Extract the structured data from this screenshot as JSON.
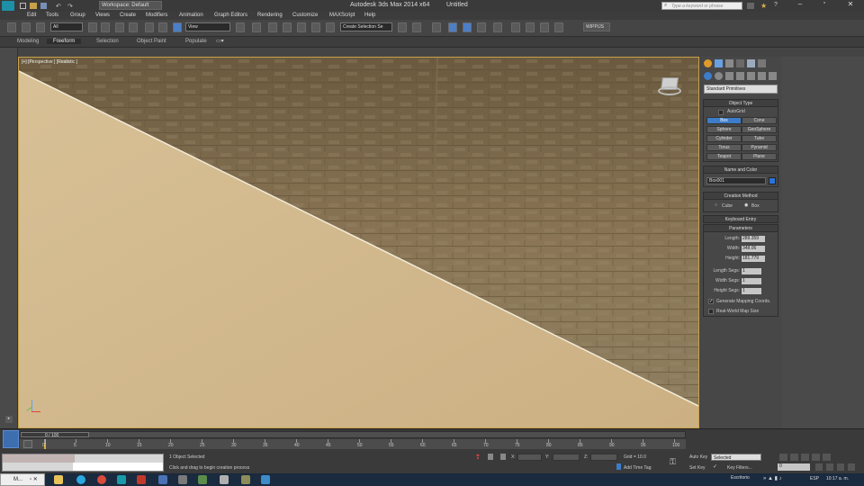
{
  "window": {
    "title": "Autodesk 3ds Max  2014 x64",
    "doc_title": "Untitled",
    "workspace": "Workspace: Default",
    "search_placeholder": "Type a keyword or phrase"
  },
  "menu": [
    "Edit",
    "Tools",
    "Group",
    "Views",
    "Create",
    "Modifiers",
    "Animation",
    "Graph Editors",
    "Rendering",
    "Customize",
    "MAXScript",
    "Help"
  ],
  "toolbar": {
    "filter": "All",
    "ref_coord": "View",
    "selection_set": "Create Selection Se",
    "vray_btn": "WIPP/JS"
  },
  "ribbon": {
    "tabs": [
      "Modeling",
      "Freeform",
      "Selection",
      "Object Paint",
      "Populate"
    ],
    "active": "Freeform"
  },
  "viewport": {
    "label": "[+] [Perspective ] [Realistic ]"
  },
  "command_panel": {
    "category": "Standard Primitives",
    "object_type_title": "Object Type",
    "autogrid": "AutoGrid",
    "object_buttons": [
      "Box",
      "Cone",
      "Sphere",
      "GeoSphere",
      "Cylinder",
      "Tube",
      "Torus",
      "Pyramid",
      "Teapot",
      "Plane"
    ],
    "selected_object": "Box",
    "name_color_title": "Name and Color",
    "object_name": "Box001",
    "object_color": "#2a73d8",
    "creation_method_title": "Creation Method",
    "creation_options": [
      "Cube",
      "Box"
    ],
    "creation_selected": "Box",
    "keyboard_entry": "Keyboard Entry",
    "parameters_title": "Parameters",
    "params": [
      {
        "label": "Length:",
        "value": "289.359"
      },
      {
        "label": "Width:",
        "value": "348.06"
      },
      {
        "label": "Height:",
        "value": "181.779"
      }
    ],
    "segs": [
      {
        "label": "Length Segs:",
        "value": "1"
      },
      {
        "label": "Width Segs:",
        "value": "1"
      },
      {
        "label": "Height Segs:",
        "value": "1"
      }
    ],
    "gen_mapping": "Generate Mapping Coords.",
    "real_world": "Real-World Map Size"
  },
  "timeline": {
    "frame_display": "0 / 100",
    "ticks": [
      "0",
      "5",
      "10",
      "15",
      "20",
      "25",
      "30",
      "35",
      "40",
      "45",
      "50",
      "55",
      "60",
      "65",
      "70",
      "75",
      "80",
      "85",
      "90",
      "95",
      "100"
    ]
  },
  "status": {
    "selection": "1 Object Selected",
    "prompt": "Click and drag to begin creation process",
    "x_label": "X:",
    "y_label": "Y:",
    "z_label": "Z:",
    "grid": "Grid = 10.0",
    "add_time_tag": "Add Time Tag",
    "auto_key": "Auto Key",
    "set_key": "Set Key",
    "selected": "Selected",
    "key_filters": "Key Filters...",
    "frame": "0",
    "mini_label": "M..."
  },
  "taskbar": {
    "desktop": "Escritorio",
    "lang": "ESP",
    "time": "10:17 a. m."
  }
}
